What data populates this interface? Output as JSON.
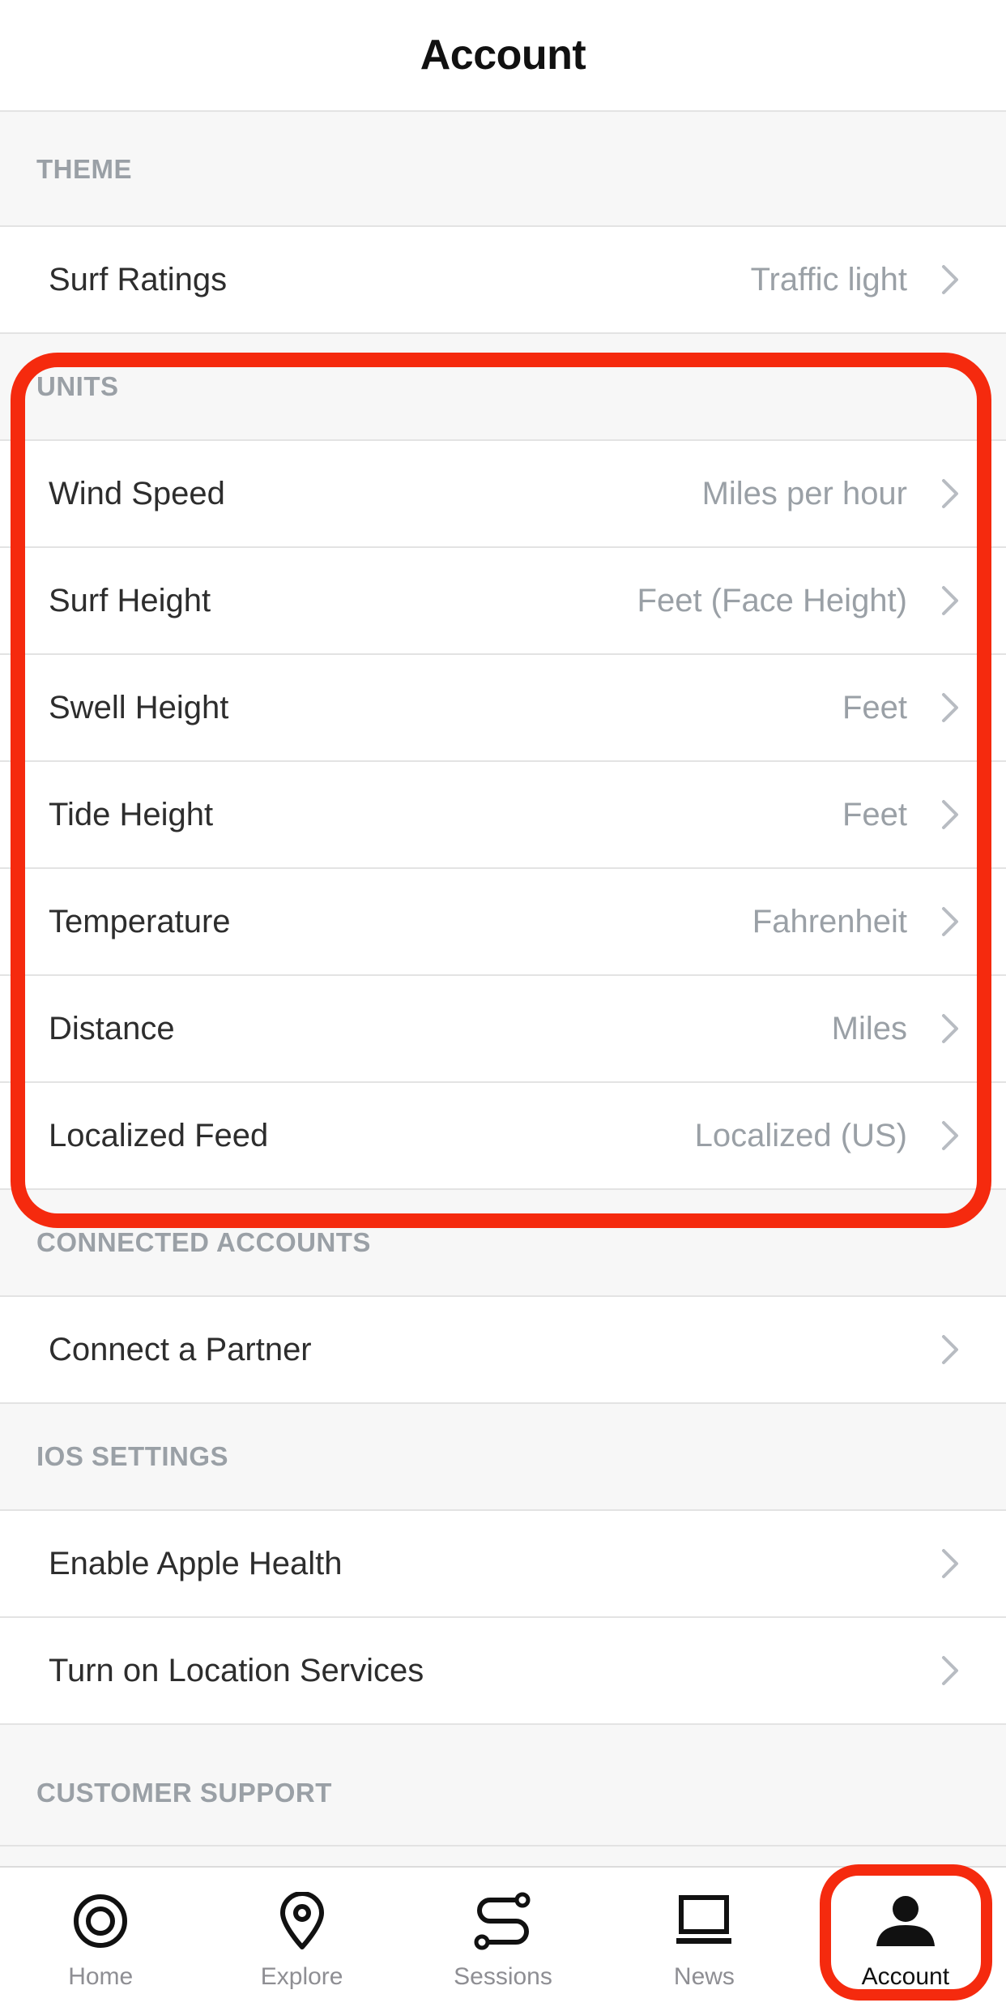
{
  "header": {
    "title": "Account"
  },
  "sections": {
    "theme": {
      "title": "THEME",
      "rows": [
        {
          "label": "Surf Ratings",
          "value": "Traffic light"
        }
      ]
    },
    "units": {
      "title": "UNITS",
      "rows": [
        {
          "label": "Wind Speed",
          "value": "Miles per hour"
        },
        {
          "label": "Surf Height",
          "value": "Feet (Face Height)"
        },
        {
          "label": "Swell Height",
          "value": "Feet"
        },
        {
          "label": "Tide Height",
          "value": "Feet"
        },
        {
          "label": "Temperature",
          "value": "Fahrenheit"
        },
        {
          "label": "Distance",
          "value": "Miles"
        },
        {
          "label": "Localized Feed",
          "value": "Localized (US)"
        }
      ]
    },
    "connected": {
      "title": "CONNECTED ACCOUNTS",
      "rows": [
        {
          "label": "Connect a Partner"
        }
      ]
    },
    "ios": {
      "title": "IOS SETTINGS",
      "rows": [
        {
          "label": "Enable Apple Health"
        },
        {
          "label": "Turn on Location Services"
        }
      ]
    },
    "support": {
      "title": "CUSTOMER SUPPORT"
    }
  },
  "tabs": [
    {
      "label": "Home",
      "icon": "home-icon"
    },
    {
      "label": "Explore",
      "icon": "map-pin-icon"
    },
    {
      "label": "Sessions",
      "icon": "route-icon"
    },
    {
      "label": "News",
      "icon": "laptop-icon"
    },
    {
      "label": "Account",
      "icon": "person-icon",
      "active": true
    }
  ],
  "colors": {
    "highlight": "#f52a0e",
    "section_text": "#9aa0a6",
    "value_text": "#9aa0a6",
    "label_text": "#2d2d2d"
  }
}
